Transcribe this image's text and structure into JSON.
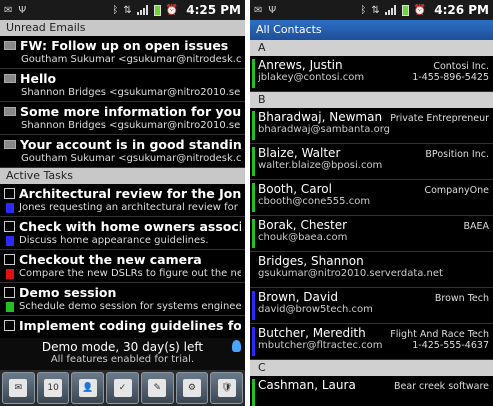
{
  "left": {
    "status": {
      "time": "4:25 PM"
    },
    "unread_header": "Unread Emails",
    "emails": [
      {
        "subject": "FW: Follow up on open issues",
        "from": "Goutham Sukumar <gsukumar@nitrodesk.co"
      },
      {
        "subject": "Hello",
        "from": "Shannon Bridges <gsukumar@nitro2010.serv"
      },
      {
        "subject": "Some more information for you",
        "from": "Shannon Bridges <gsukumar@nitro2010.serve"
      },
      {
        "subject": "Your account is in good standing",
        "from": "Goutham Sukumar <gsukumar@nitrodesk.co"
      }
    ],
    "tasks_header": "Active Tasks",
    "tasks": [
      {
        "title": "Architectural review for the Jones h",
        "detail": "Jones requesting an architectural review for t",
        "color": "#2a2aff"
      },
      {
        "title": "Check with home owners association",
        "detail": "Discuss home appearance guidelines.",
        "color": "#2a2aff"
      },
      {
        "title": "Checkout the new camera",
        "detail": "Compare the new DSLRs to figure out the nex",
        "color": "#e01010"
      },
      {
        "title": "Demo session",
        "detail": "Schedule demo session for systems engineers",
        "color": "#22c022"
      },
      {
        "title": "Implement coding guidelines for Pr",
        "detail": "",
        "color": "#22c022"
      }
    ],
    "demo": {
      "line1": "Demo mode, 30 day(s) left",
      "line2": "All features enabled for trial."
    },
    "toolbar": [
      {
        "icon": "mail-icon",
        "text": "✉"
      },
      {
        "icon": "calendar-icon",
        "text": "10"
      },
      {
        "icon": "contacts-icon",
        "text": "👤"
      },
      {
        "icon": "tasks-icon",
        "text": "✓"
      },
      {
        "icon": "notes-icon",
        "text": "✎"
      },
      {
        "icon": "settings-icon",
        "text": "⚙"
      },
      {
        "icon": "security-icon",
        "text": "🛡"
      }
    ]
  },
  "right": {
    "status": {
      "time": "4:26 PM"
    },
    "title": "All Contacts",
    "groups": [
      {
        "letter": "A",
        "contacts": [
          {
            "name": "Anrews, Justin",
            "company": "Contosi Inc.",
            "email": "jblakey@contosi.com",
            "phone": "1-455-896-5425",
            "color": "#22c022"
          }
        ]
      },
      {
        "letter": "B",
        "contacts": [
          {
            "name": "Bharadwaj, Newman",
            "company": "Private Entrepreneur",
            "email": "bharadwaj@sambanta.org",
            "phone": "",
            "color": "#22c022"
          },
          {
            "name": "Blaize, Walter",
            "company": "BPosition Inc.",
            "email": "walter.blaize@bposi.com",
            "phone": "",
            "color": "#22c022"
          },
          {
            "name": "Booth, Carol",
            "company": "CompanyOne",
            "email": "cbooth@cone555.com",
            "phone": "",
            "color": "#22c022"
          },
          {
            "name": "Borak, Chester",
            "company": "BAEA",
            "email": "chouk@baea.com",
            "phone": "",
            "color": "#22c022"
          },
          {
            "name": "Bridges, Shannon",
            "company": "",
            "email": "gsukumar@nitro2010.serverdata.net",
            "phone": "",
            "color": "#000000"
          },
          {
            "name": "Brown, David",
            "company": "Brown Tech",
            "email": "david@brow5tech.com",
            "phone": "",
            "color": "#2a2aff"
          },
          {
            "name": "Butcher, Meredith",
            "company": "Flight And Race Tech",
            "email": "mbutcher@fltractec.com",
            "phone": "1-425-555-4637",
            "color": "#2a2aff"
          }
        ]
      },
      {
        "letter": "C",
        "contacts": [
          {
            "name": "Cashman, Laura",
            "company": "Bear creek software",
            "email": "",
            "phone": "",
            "color": "#22c022"
          }
        ]
      }
    ]
  }
}
